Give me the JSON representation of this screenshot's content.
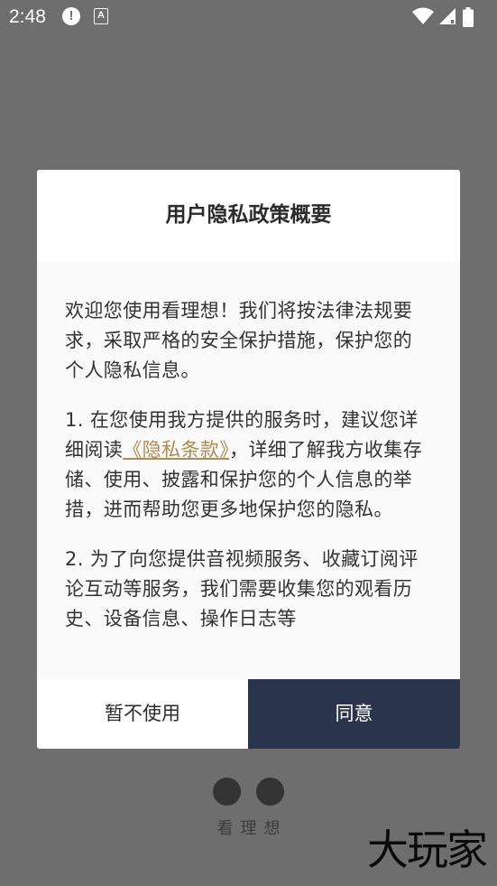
{
  "status_bar": {
    "time": "2:48",
    "alert_glyph": "!",
    "text_glyph": "A",
    "icons": [
      "alert-icon",
      "a-text-icon",
      "wifi-icon",
      "cell-signal-icon",
      "battery-icon"
    ]
  },
  "dialog": {
    "title": "用户隐私政策概要",
    "paragraphs": {
      "p1": "欢迎您使用看理想！我们将按法律法规要求，采取严格的安全保护措施，保护您的个人隐私信息。",
      "p2_before": "1. 在您使用我方提供的服务时，建议您详细阅读",
      "p2_link": "《隐私条款》",
      "p2_after": "，详细了解我方收集存储、使用、披露和保护您的个人信息的举措，进而帮助您更多地保护您的隐私。",
      "p3": "2. 为了向您提供音视频服务、收藏订阅评论互动等服务，我们需要收集您的观看历史、设备信息、操作日志等"
    },
    "decline_label": "暂不使用",
    "agree_label": "同意"
  },
  "colors": {
    "overlay": "#6e6e6e",
    "link": "#b08b4f",
    "agree_button": "#2a344d"
  },
  "brand": {
    "caption": "看理想"
  },
  "watermark": {
    "text": "大玩家"
  }
}
